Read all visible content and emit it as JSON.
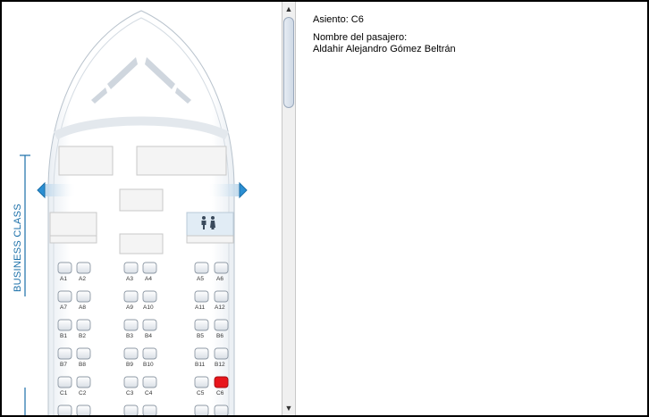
{
  "info": {
    "seat_line": "Asiento: C6",
    "passenger_label": "Nombre del pasajero:",
    "passenger_name": "Aldahir Alejandro Gómez Beltrán"
  },
  "cabin": {
    "section_label": "BUSINESS CLASS",
    "selected_seat": "C6"
  },
  "seats": [
    [
      "A1",
      "A2",
      "A3",
      "A4",
      "A5",
      "A6"
    ],
    [
      "A7",
      "A8",
      "A9",
      "A10",
      "A11",
      "A12"
    ],
    [
      "B1",
      "B2",
      "B3",
      "B4",
      "B5",
      "B6"
    ],
    [
      "B7",
      "B8",
      "B9",
      "B10",
      "B11",
      "B12"
    ],
    [
      "C1",
      "C2",
      "C3",
      "C4",
      "C5",
      "C6"
    ]
  ],
  "colors": {
    "accent": "#1a6fa8",
    "selected": "#e8151b",
    "seat": "#eef1f5"
  },
  "icons": [
    "restroom-icon",
    "exit-arrow-left-icon",
    "exit-arrow-right-icon",
    "scroll-up-icon",
    "scroll-down-icon"
  ]
}
